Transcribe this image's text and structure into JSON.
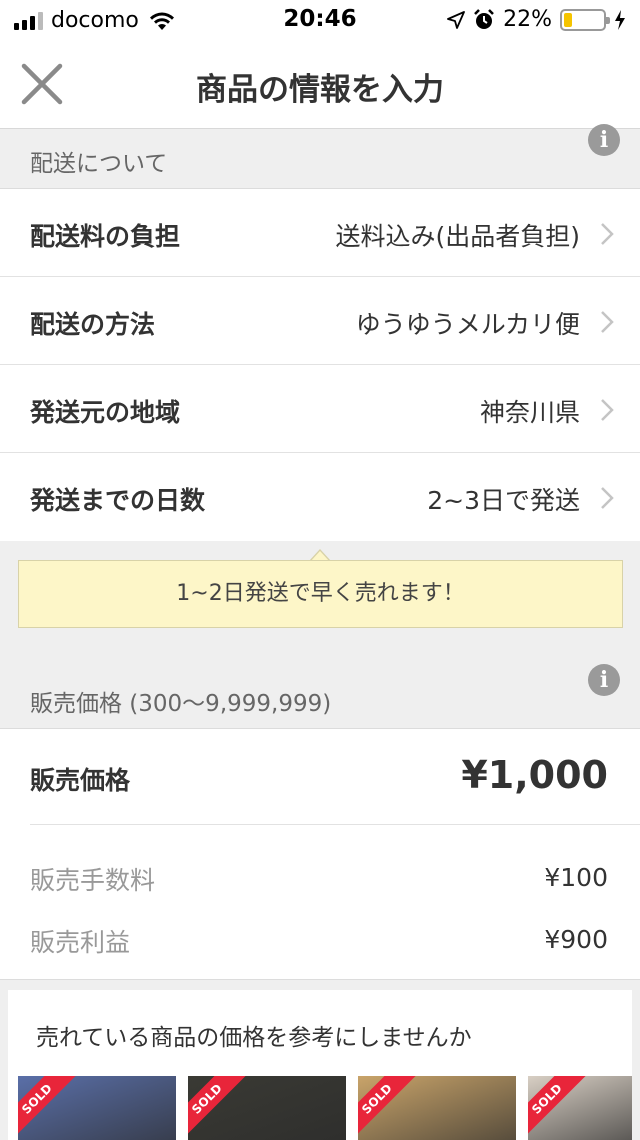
{
  "status_bar": {
    "carrier": "docomo",
    "time": "20:46",
    "battery_percent": "22%",
    "battery_level": 0.22,
    "icons": [
      "signal-icon",
      "wifi-icon",
      "location-arrow-icon",
      "alarm-icon",
      "battery-icon",
      "charging-icon"
    ]
  },
  "nav": {
    "title": "商品の情報を入力",
    "close_icon": "close-icon"
  },
  "shipping_section": {
    "header": "配送について",
    "rows": [
      {
        "label": "配送料の負担",
        "value": "送料込み(出品者負担)"
      },
      {
        "label": "配送の方法",
        "value": "ゆうゆうメルカリ便"
      },
      {
        "label": "発送元の地域",
        "value": "神奈川県"
      },
      {
        "label": "発送までの日数",
        "value": "2~3日で発送"
      }
    ]
  },
  "tip": {
    "text": "1~2日発送で早く売れます！"
  },
  "price_section": {
    "header": "販売価格 (300〜9,999,999)",
    "price_label": "販売価格",
    "price_value": "¥1,000",
    "fee_label": "販売手数料",
    "fee_value": "¥100",
    "profit_label": "販売利益",
    "profit_value": "¥900"
  },
  "reference": {
    "title": "売れている商品の価格を参考にしませんか",
    "items": [
      {
        "tag": "SOLD",
        "color": "#5a6fa8"
      },
      {
        "tag": "SOLD",
        "color": "#3a3a34"
      },
      {
        "tag": "SOLD",
        "color": "#c9a46a"
      },
      {
        "tag": "SOLD",
        "color": "#d8cfc4"
      }
    ]
  },
  "colors": {
    "background": "#efefef",
    "tip_background": "#fdf6c8",
    "sold_red": "#e8253a",
    "battery_yellow": "#f5c400"
  }
}
